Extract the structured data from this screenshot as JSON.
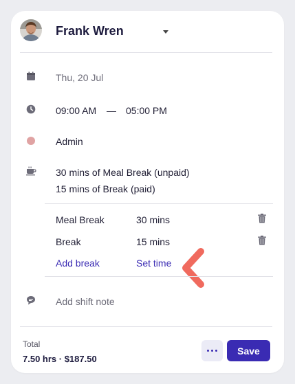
{
  "header": {
    "name": "Frank Wren"
  },
  "shift": {
    "date": "Thu, 20 Jul",
    "start_time": "09:00 AM",
    "dash": "—",
    "end_time": "05:00 PM",
    "role": "Admin",
    "role_color": "#e0a3a3",
    "break_summary": [
      "30 mins of Meal Break (unpaid)",
      "15 mins of Break (paid)"
    ]
  },
  "breaks": [
    {
      "type": "Meal Break",
      "duration": "30 mins"
    },
    {
      "type": "Break",
      "duration": "15 mins"
    }
  ],
  "actions": {
    "add_break": "Add break",
    "set_time": "Set time"
  },
  "note": {
    "placeholder": "Add shift note"
  },
  "footer": {
    "total_label": "Total",
    "total_value": "7.50 hrs · $187.50",
    "save_label": "Save"
  },
  "colors": {
    "accent": "#3a2bb3",
    "arrow": "#f06a5e"
  },
  "icons": {
    "date": "calendar-icon",
    "time": "clock-icon",
    "role": "role-dot-icon",
    "breaks": "coffee-cup-icon",
    "note": "comment-icon",
    "delete": "trash-icon",
    "more": "more-dots-icon",
    "annotation": "chevron-left-annotation-icon"
  }
}
